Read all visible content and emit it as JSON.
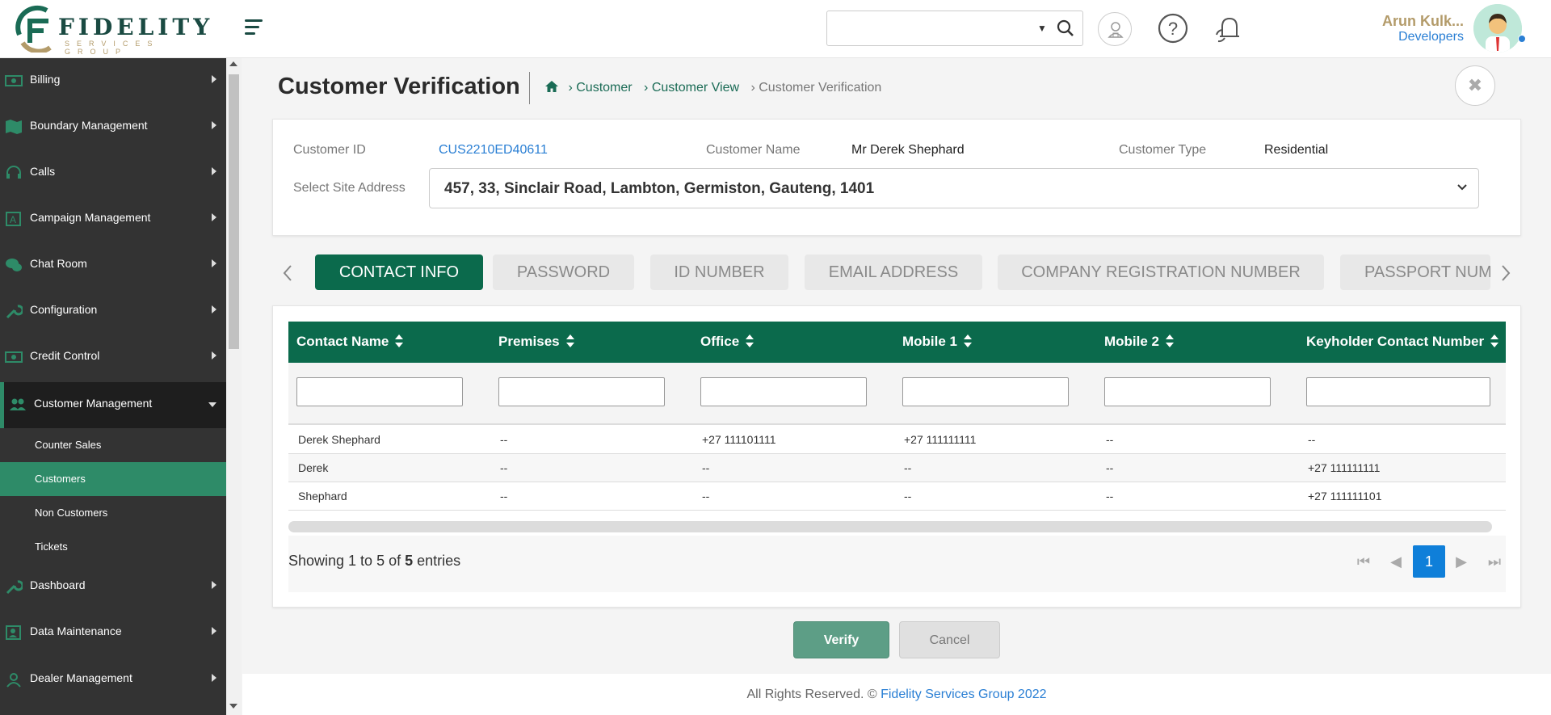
{
  "header": {
    "logo_text": "FIDELITY",
    "logo_subtext": "SERVICES GROUP",
    "user_name": "Arun Kulk...",
    "user_role": "Developers"
  },
  "sidebar": {
    "items": [
      {
        "label": "Billing",
        "icon": "billing-icon"
      },
      {
        "label": "Boundary Management",
        "icon": "map-icon"
      },
      {
        "label": "Calls",
        "icon": "headset-icon"
      },
      {
        "label": "Campaign Management",
        "icon": "campaign-icon"
      },
      {
        "label": "Chat Room",
        "icon": "chat-icon"
      },
      {
        "label": "Configuration",
        "icon": "wrench-icon"
      },
      {
        "label": "Credit Control",
        "icon": "money-icon"
      },
      {
        "label": "Customer Management",
        "icon": "users-icon"
      },
      {
        "label": "Dashboard",
        "icon": "wrench-icon"
      },
      {
        "label": "Data Maintenance",
        "icon": "person-card-icon"
      },
      {
        "label": "Dealer Management",
        "icon": "user-icon"
      }
    ],
    "sub_items": [
      {
        "label": "Counter Sales"
      },
      {
        "label": "Customers"
      },
      {
        "label": "Non Customers"
      },
      {
        "label": "Tickets"
      }
    ]
  },
  "page": {
    "title": "Customer Verification",
    "breadcrumb": [
      "Customer",
      "Customer View",
      "Customer Verification"
    ]
  },
  "info": {
    "customer_id_label": "Customer ID",
    "customer_id": "CUS2210ED40611",
    "customer_name_label": "Customer Name",
    "customer_name": "Mr Derek Shephard",
    "customer_type_label": "Customer Type",
    "customer_type": "Residential",
    "site_address_label": "Select Site Address",
    "site_address": "457, 33, Sinclair Road, Lambton, Germiston, Gauteng, 1401"
  },
  "tabs": [
    "CONTACT INFO",
    "PASSWORD",
    "ID NUMBER",
    "EMAIL ADDRESS",
    "COMPANY REGISTRATION NUMBER",
    "PASSPORT NUM"
  ],
  "table": {
    "columns": [
      "Contact Name",
      "Premises",
      "Office",
      "Mobile 1",
      "Mobile 2",
      "Keyholder Contact Number"
    ],
    "rows": [
      [
        "Derek Shephard",
        "--",
        "+27 111101111",
        "+27 111111111",
        "--",
        "--"
      ],
      [
        "Derek",
        "--",
        "--",
        "--",
        "--",
        "+27 111111111"
      ],
      [
        "Shephard",
        "--",
        "--",
        "--",
        "--",
        "+27 111111101"
      ]
    ],
    "showing_prefix": "Showing 1 to 5 of ",
    "total": "5",
    "showing_suffix": " entries",
    "current_page": "1"
  },
  "buttons": {
    "verify": "Verify",
    "cancel": "Cancel"
  },
  "footer": {
    "text": "All Rights Reserved. © ",
    "link": "Fidelity Services Group 2022"
  },
  "colors": {
    "brand_green": "#0b6a4c",
    "sidebar_bg": "#333333",
    "active_sub": "#2e8b68",
    "link_blue": "#2a7fd4",
    "logo_gold": "#b39b6a"
  }
}
